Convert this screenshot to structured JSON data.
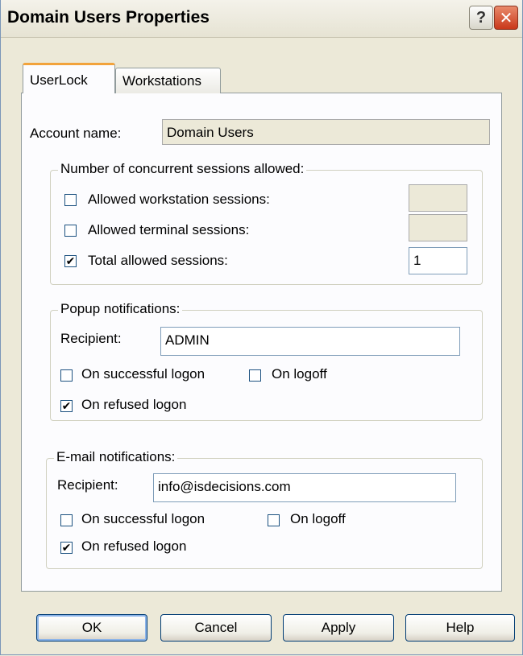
{
  "window": {
    "title": "Domain Users Properties"
  },
  "titlebar": {
    "help_glyph": "?",
    "close_glyph": "✕"
  },
  "tabs": [
    {
      "label": "UserLock",
      "active": true
    },
    {
      "label": "Workstations",
      "active": false
    }
  ],
  "account": {
    "label": "Account name:",
    "value": "Domain Users"
  },
  "sessions": {
    "legend": "Number of concurrent sessions allowed:",
    "items": [
      {
        "label": "Allowed workstation sessions:",
        "checked": false,
        "value": ""
      },
      {
        "label": "Allowed terminal sessions:",
        "checked": false,
        "value": ""
      },
      {
        "label": "Total allowed sessions:",
        "checked": true,
        "value": "1"
      }
    ]
  },
  "popup": {
    "legend": "Popup notifications:",
    "recipient_label": "Recipient:",
    "recipient_value": "ADMIN",
    "on_success": {
      "label": "On successful logon",
      "checked": false
    },
    "on_logoff": {
      "label": "On logoff",
      "checked": false
    },
    "on_refused": {
      "label": "On refused logon",
      "checked": true
    }
  },
  "email": {
    "legend": "E-mail notifications:",
    "recipient_label": "Recipient:",
    "recipient_value": "info@isdecisions.com",
    "on_success": {
      "label": "On successful logon",
      "checked": false
    },
    "on_logoff": {
      "label": "On logoff",
      "checked": false
    },
    "on_refused": {
      "label": "On refused logon",
      "checked": true
    }
  },
  "buttons": {
    "ok": "OK",
    "cancel": "Cancel",
    "apply": "Apply",
    "help": "Help"
  },
  "check_glyph": "✔"
}
